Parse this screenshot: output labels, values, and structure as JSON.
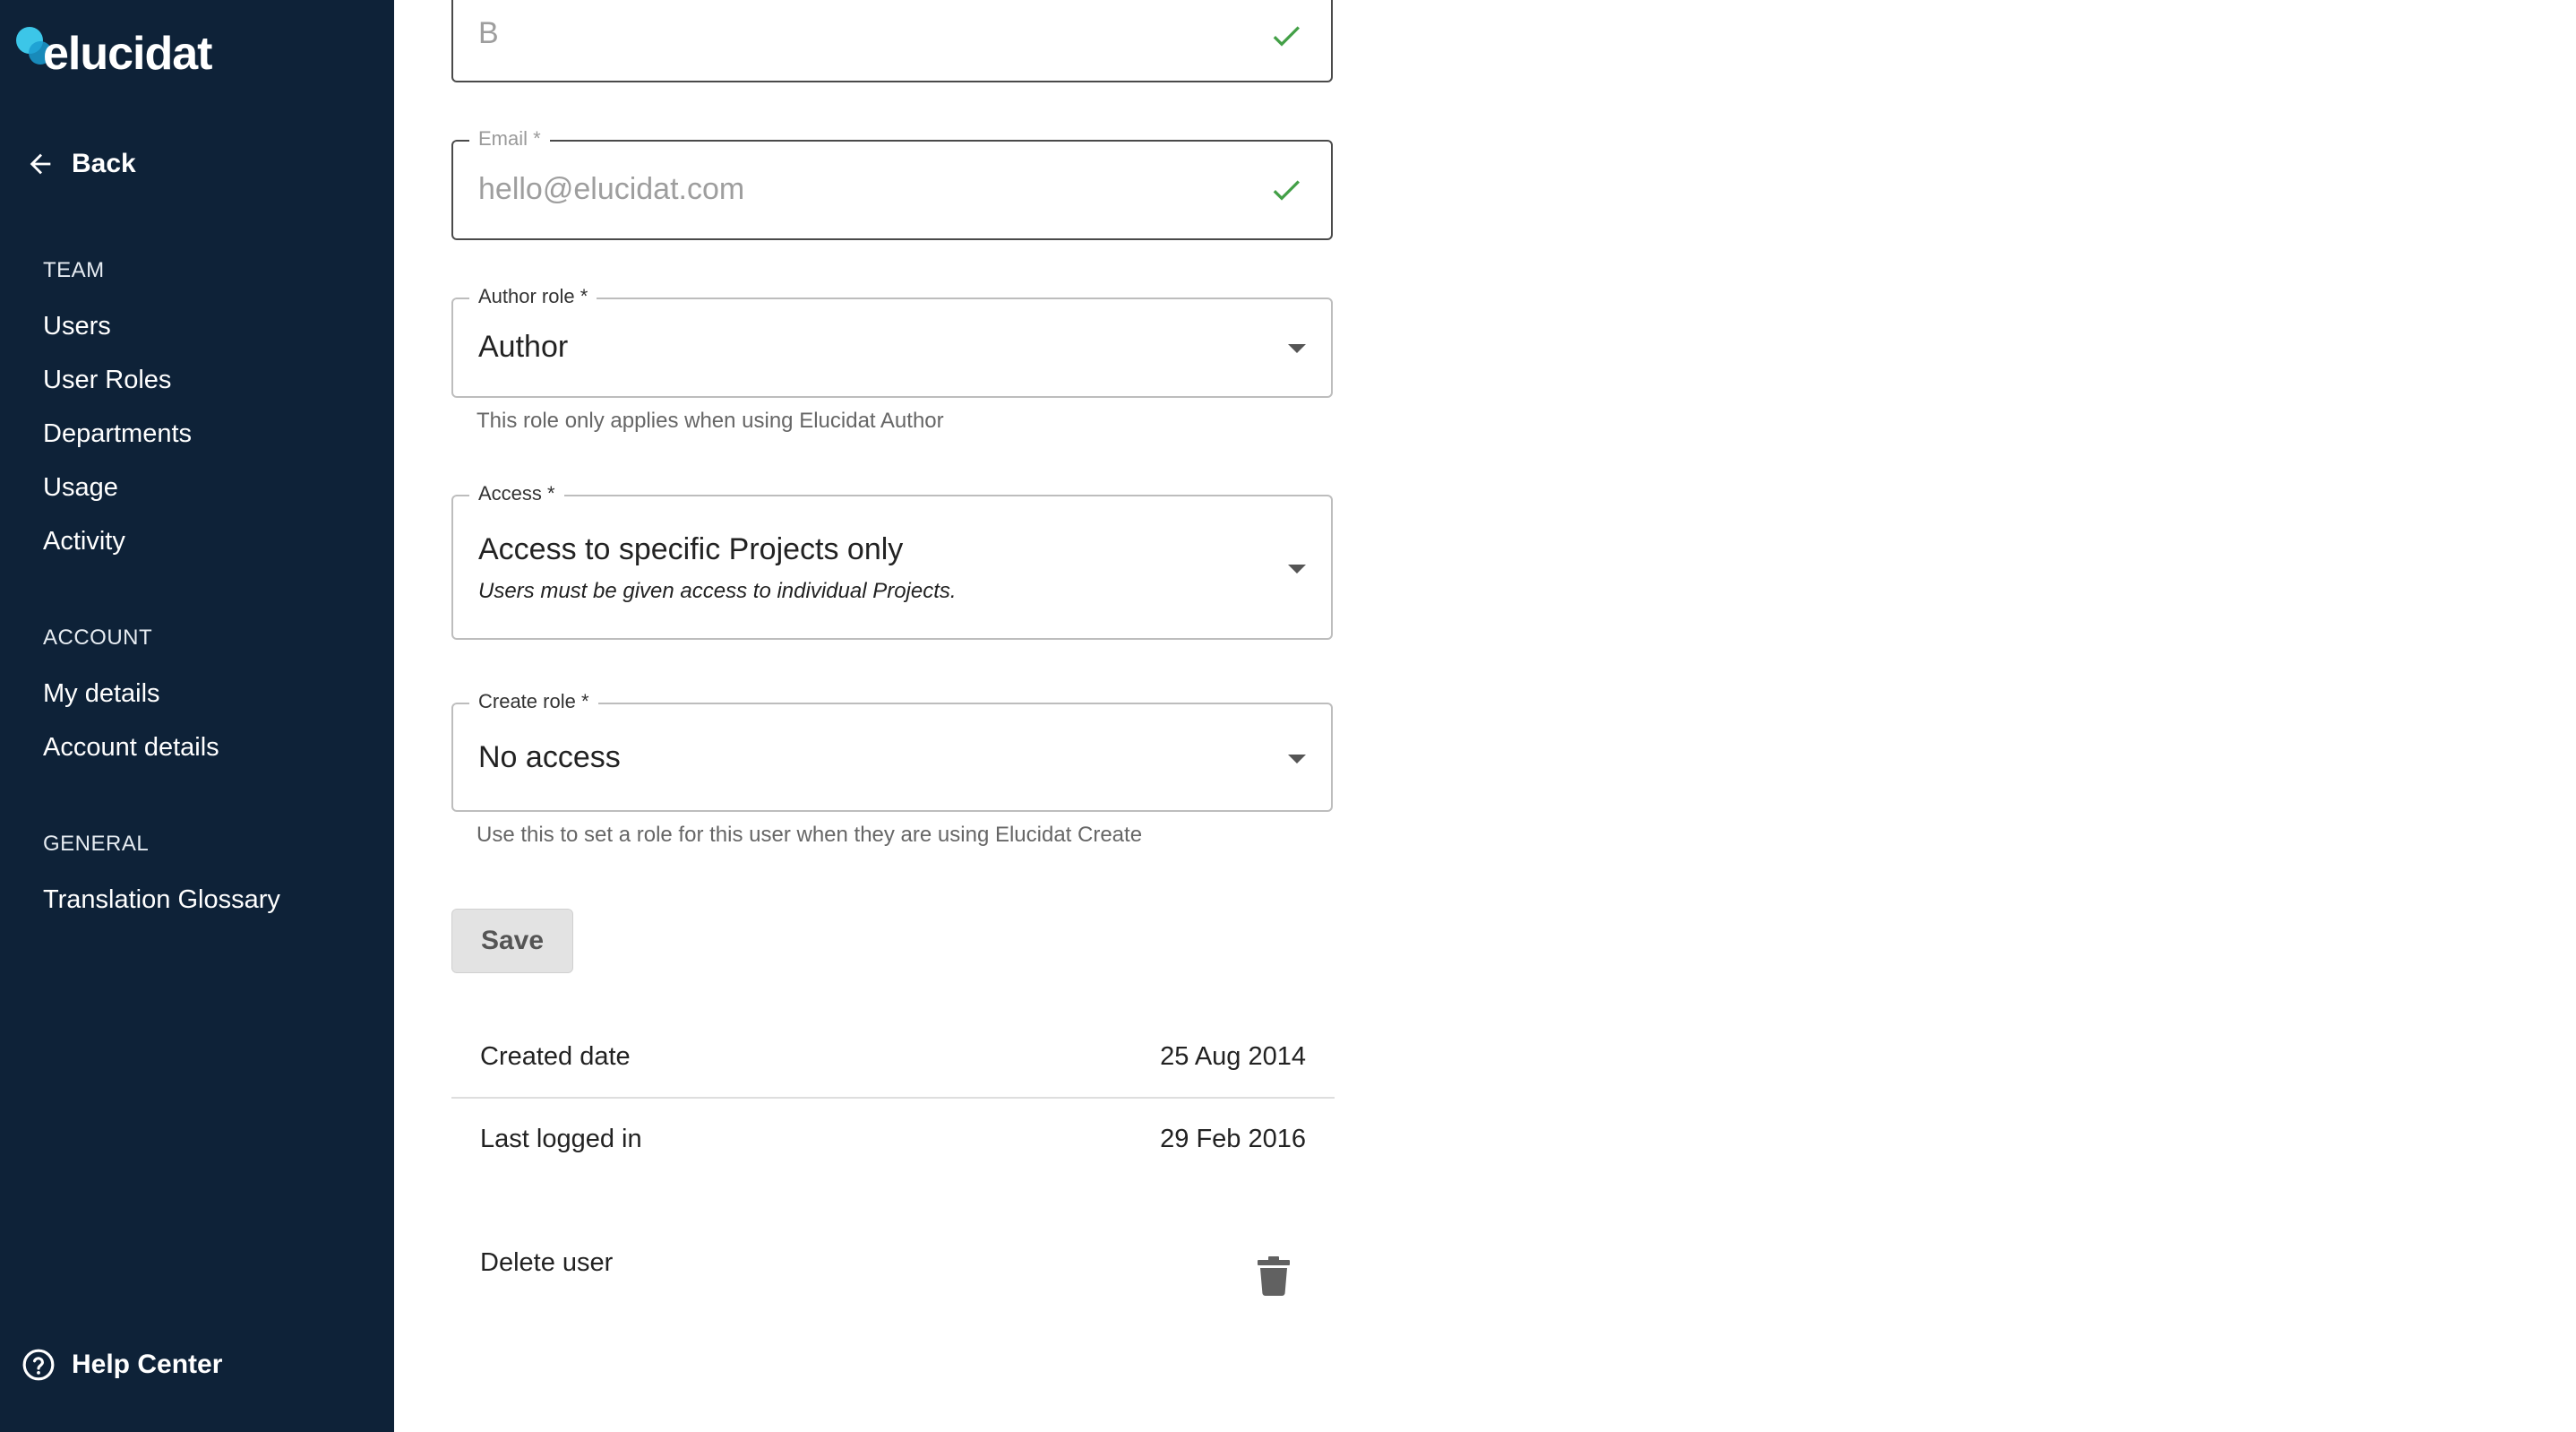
{
  "brand": {
    "name": "elucidat"
  },
  "sidebar": {
    "back_label": "Back",
    "sections": [
      {
        "title": "TEAM",
        "items": [
          "Users",
          "User Roles",
          "Departments",
          "Usage",
          "Activity"
        ]
      },
      {
        "title": "ACCOUNT",
        "items": [
          "My details",
          "Account details"
        ]
      },
      {
        "title": "GENERAL",
        "items": [
          "Translation Glossary"
        ]
      }
    ],
    "help_label": "Help Center"
  },
  "form": {
    "last_name": {
      "value": "B"
    },
    "email": {
      "label": "Email *",
      "value": "hello@elucidat.com"
    },
    "author_role": {
      "label": "Author role *",
      "value": "Author",
      "helper": "This role only applies when using Elucidat Author"
    },
    "access": {
      "label": "Access *",
      "value": "Access to specific Projects only",
      "description": "Users must be given access to individual Projects."
    },
    "create_role": {
      "label": "Create role *",
      "value": "No access",
      "helper": "Use this to set a role for this user when they are using Elucidat Create"
    },
    "save_label": "Save"
  },
  "info": {
    "created": {
      "label": "Created date",
      "value": "25 Aug 2014"
    },
    "last_login": {
      "label": "Last logged in",
      "value": "29 Feb 2016"
    },
    "delete_label": "Delete user"
  },
  "colors": {
    "sidebar_bg": "#0e2238",
    "check_green": "#43a047",
    "brand_cyan": "#3cc6e8"
  },
  "icons": {
    "back": "arrow-left-icon",
    "valid": "check-icon",
    "dropdown": "caret-down-icon",
    "delete": "trash-icon",
    "help": "help-circle-icon"
  }
}
